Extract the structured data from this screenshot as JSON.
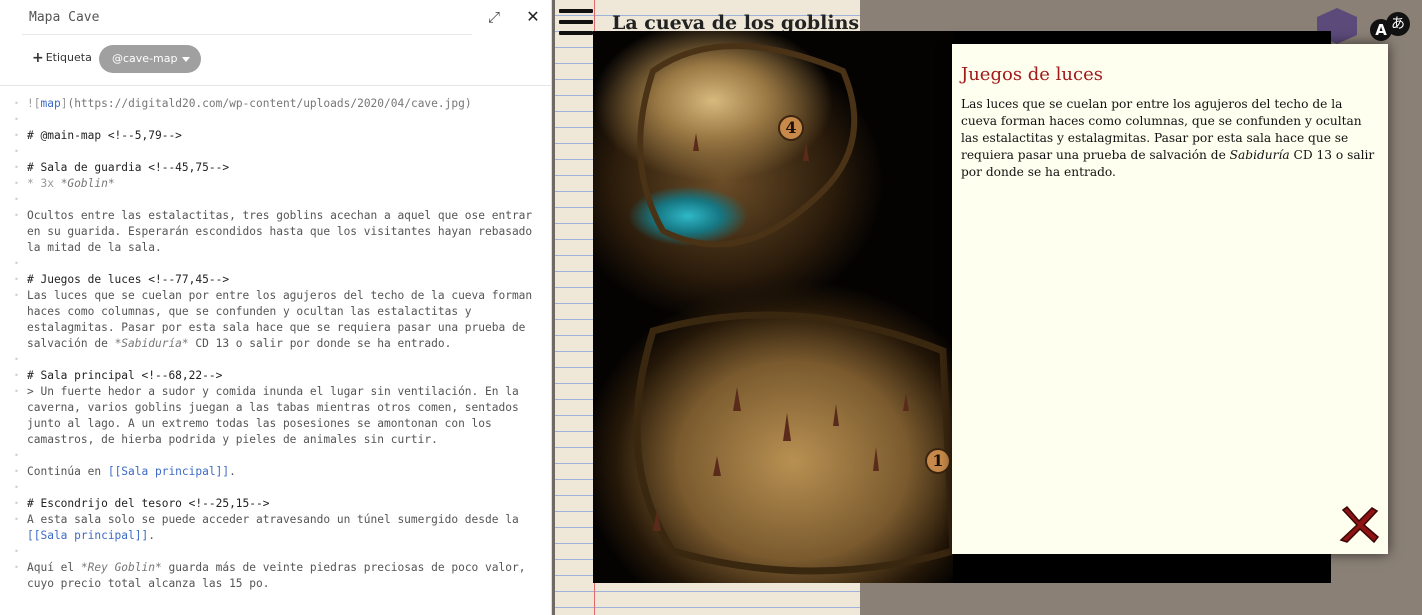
{
  "editor": {
    "title": "Mapa Cave",
    "add_tag_label": "Etiqueta",
    "tag": "@cave-map",
    "lines": [
      {
        "segs": [
          [
            "k",
            "!["
          ],
          [
            "lk",
            "map"
          ],
          [
            "k",
            "]"
          ],
          [
            "u",
            "(https://digitald20.com/wp-content/uploads/2020/04/cave.jpg)"
          ]
        ]
      },
      {
        "segs": []
      },
      {
        "segs": [
          [
            "h",
            "# @main-map <!--5,79-->"
          ]
        ]
      },
      {
        "segs": []
      },
      {
        "segs": [
          [
            "h",
            "# Sala de guardia <!--45,75-->"
          ]
        ]
      },
      {
        "segs": [
          [
            "k",
            "* 3x "
          ],
          [
            "em",
            "*Goblin*"
          ]
        ]
      },
      {
        "segs": []
      },
      {
        "segs": [
          [
            "t",
            "Ocultos entre las estalactitas, tres goblins acechan a aquel que ose entrar"
          ]
        ]
      },
      {
        "cont": true,
        "segs": [
          [
            "t",
            "en su guarida. Esperarán escondidos hasta que los visitantes hayan rebasado"
          ]
        ]
      },
      {
        "cont": true,
        "segs": [
          [
            "t",
            "la mitad de la sala."
          ]
        ]
      },
      {
        "segs": []
      },
      {
        "segs": [
          [
            "h",
            "# Juegos de luces <!--77,45-->"
          ]
        ]
      },
      {
        "segs": [
          [
            "t",
            "Las luces que se cuelan por entre los agujeros del techo de la cueva forman"
          ]
        ]
      },
      {
        "cont": true,
        "segs": [
          [
            "t",
            "haces como columnas, que se confunden y ocultan las estalactitas y"
          ]
        ]
      },
      {
        "cont": true,
        "segs": [
          [
            "t",
            "estalagmitas. Pasar por esta sala hace que se requiera pasar una prueba de"
          ]
        ]
      },
      {
        "cont": true,
        "segs": [
          [
            "t",
            "salvación de "
          ],
          [
            "em",
            "*Sabiduría*"
          ],
          [
            "t",
            " CD 13 o salir por donde se ha entrado."
          ]
        ]
      },
      {
        "segs": []
      },
      {
        "segs": [
          [
            "h",
            "# Sala principal <!--68,22-->"
          ]
        ]
      },
      {
        "segs": [
          [
            "t",
            "> Un fuerte hedor a sudor y comida inunda el lugar sin ventilación. En la"
          ]
        ]
      },
      {
        "cont": true,
        "segs": [
          [
            "t",
            "caverna, varios goblins juegan a las tabas mientras otros comen, sentados"
          ]
        ]
      },
      {
        "cont": true,
        "segs": [
          [
            "t",
            "junto al lago. A un extremo todas las posesiones se amontonan con los"
          ]
        ]
      },
      {
        "cont": true,
        "segs": [
          [
            "t",
            "camastros, de hierba podrida y pieles de animales sin curtir."
          ]
        ]
      },
      {
        "segs": []
      },
      {
        "segs": [
          [
            "t",
            "Continúa en "
          ],
          [
            "lk",
            "[[Sala principal]]"
          ],
          [
            "t",
            "."
          ]
        ]
      },
      {
        "segs": []
      },
      {
        "segs": [
          [
            "h",
            "# Escondrijo del tesoro <!--25,15-->"
          ]
        ]
      },
      {
        "segs": [
          [
            "t",
            "A esta sala solo se puede acceder atravesando un túnel sumergido desde la"
          ]
        ]
      },
      {
        "cont": true,
        "segs": [
          [
            "lk",
            "[[Sala principal]]"
          ],
          [
            "t",
            "."
          ]
        ]
      },
      {
        "segs": []
      },
      {
        "segs": [
          [
            "t",
            "Aquí el "
          ],
          [
            "em",
            "*Rey Goblin*"
          ],
          [
            "t",
            " guarda más de veinte piedras preciosas de poco valor,"
          ]
        ]
      },
      {
        "cont": true,
        "segs": [
          [
            "t",
            "cuyo precio total alcanza las 15 po."
          ]
        ]
      }
    ]
  },
  "background": {
    "notebook_title": "La cueva de los goblins"
  },
  "translate": {
    "a": "A",
    "b": "あ"
  },
  "markers": [
    {
      "label": "4",
      "room": "Juegos de luces"
    },
    {
      "label": "1",
      "room": "Sala de guardia"
    }
  ],
  "popup": {
    "title": "Juegos de luces",
    "text_before": "Las luces que se cuelan por entre los agujeros del techo de la cueva forman haces como columnas, que se confunden y ocultan las estalactitas y estalagmitas. Pasar por esta sala hace que se requiera pasar una prueba de salvación de ",
    "text_em": "Sabiduría",
    "text_after": " CD 13 o salir por donde se ha entrado."
  },
  "colors": {
    "popup_title": "#a11a1a",
    "link": "#3c6bc4",
    "popup_bg": "#fffff0"
  }
}
